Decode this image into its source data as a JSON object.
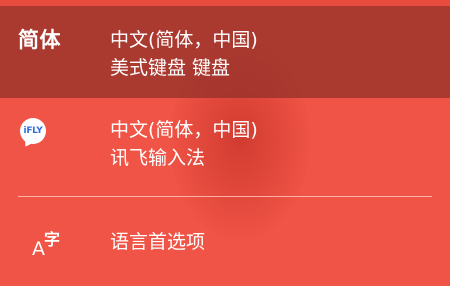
{
  "menu": {
    "items": [
      {
        "badge": "简体",
        "title": "中文(简体，中国)",
        "subtitle": "美式键盘 键盘",
        "selected": true
      },
      {
        "icon": "ifly-logo-icon",
        "icon_text": "iFLY",
        "title": "中文(简体，中国)",
        "subtitle": "讯飞输入法",
        "selected": false
      },
      {
        "icon": "language-preferences-icon",
        "icon_glyph_latin": "A",
        "icon_glyph_cjk": "字",
        "title": "语言首选项"
      }
    ]
  },
  "colors": {
    "background": "#f05446",
    "selected_row": "#a7433a",
    "text": "#ffffff",
    "ifly_blue": "#2f6fde"
  }
}
